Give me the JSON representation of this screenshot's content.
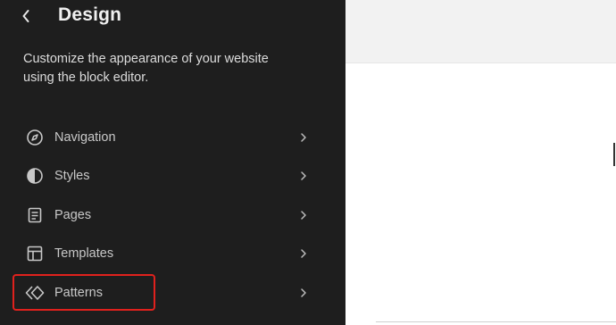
{
  "sidebar": {
    "title": "Design",
    "description": "Customize the appearance of your website using the block editor.",
    "items": [
      {
        "label": "Navigation",
        "icon": "navigation-icon"
      },
      {
        "label": "Styles",
        "icon": "styles-icon"
      },
      {
        "label": "Pages",
        "icon": "pages-icon"
      },
      {
        "label": "Templates",
        "icon": "templates-icon"
      },
      {
        "label": "Patterns",
        "icon": "patterns-icon"
      }
    ]
  },
  "colors": {
    "sidebar_bg": "#1e1e1e",
    "highlight": "#e0211d",
    "preview_header_bg": "#f2f2f2",
    "preview_bg": "#ffffff"
  }
}
